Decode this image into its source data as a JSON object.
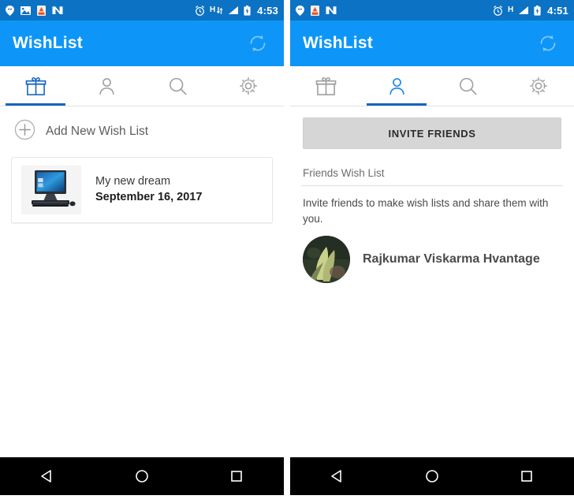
{
  "colors": {
    "statusbar": "#0c72c4",
    "appbar": "#0d96f7",
    "tab_active": "#1565c0",
    "tab_inactive": "#9e9e9e",
    "button_gray": "#d6d6d6",
    "navbar": "#000000"
  },
  "panels": [
    {
      "id": "left",
      "statusbar": {
        "left_icons": [
          "location-pin-icon",
          "photos-icon",
          "alert-app-icon",
          "nougat-n-icon"
        ],
        "right_icons": [
          "alarm-clock-icon",
          "hspa-data-icon",
          "signal-bars-icon",
          "battery-icon"
        ],
        "hspa_letter": "H",
        "time": "4:53"
      },
      "appbar": {
        "title": "WishList",
        "action_icon": "refresh-sync-icon"
      },
      "tabs": [
        {
          "icon": "gift-icon",
          "name": "tab-wishlists",
          "active": true
        },
        {
          "icon": "person-icon",
          "name": "tab-friends",
          "active": false
        },
        {
          "icon": "search-icon",
          "name": "tab-search",
          "active": false
        },
        {
          "icon": "settings-icon",
          "name": "tab-settings",
          "active": false
        }
      ],
      "content": {
        "add_new": {
          "icon": "plus-circle-icon",
          "label": "Add New Wish List"
        },
        "wish_items": [
          {
            "thumbnail": "desktop-computer-icon",
            "title": "My new dream",
            "date": "September 16, 2017"
          }
        ]
      },
      "navbar": {
        "back": "back-triangle-icon",
        "home": "home-circle-icon",
        "recents": "recents-square-icon"
      }
    },
    {
      "id": "right",
      "statusbar": {
        "left_icons": [
          "location-pin-icon",
          "alert-app-icon",
          "nougat-n-icon"
        ],
        "right_icons": [
          "alarm-clock-icon",
          "hspa-data-icon",
          "signal-bars-icon",
          "battery-icon"
        ],
        "hspa_letter": "H",
        "time": "4:51"
      },
      "appbar": {
        "title": "WishList",
        "action_icon": "refresh-sync-icon"
      },
      "tabs": [
        {
          "icon": "gift-icon",
          "name": "tab-wishlists",
          "active": false
        },
        {
          "icon": "person-icon",
          "name": "tab-friends",
          "active": true
        },
        {
          "icon": "search-icon",
          "name": "tab-search",
          "active": false
        },
        {
          "icon": "settings-icon",
          "name": "tab-settings",
          "active": false
        }
      ],
      "content": {
        "invite_button_label": "INVITE FRIENDS",
        "section_label": "Friends Wish List",
        "description": "Invite friends to make wish lists and share them with you.",
        "friends": [
          {
            "avatar": "user-photo-avatar",
            "name": "Rajkumar Viskarma Hvantage"
          }
        ]
      },
      "navbar": {
        "back": "back-triangle-icon",
        "home": "home-circle-icon",
        "recents": "recents-square-icon"
      }
    }
  ]
}
